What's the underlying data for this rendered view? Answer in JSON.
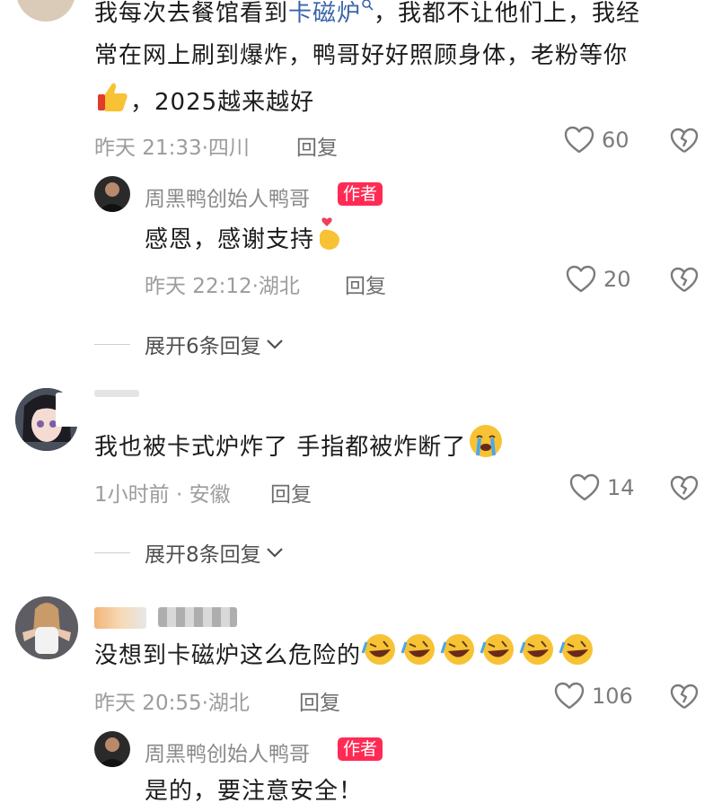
{
  "comments": [
    {
      "text_before": "我每次去餐馆看到",
      "keyword": "卡磁炉",
      "text_line1_rest": "，我都不让他们上，我经",
      "text_line2": "常在网上刷到爆炸，鸭哥好好照顾身体，老粉等你",
      "text_line3": "，2025越来越好",
      "time": "昨天 21:33",
      "location": "四川",
      "reply_label": "回复",
      "likes": "60",
      "author_reply": {
        "name": "周黑鸭创始人鸭哥",
        "badge": "作者",
        "text": "感恩，感谢支持",
        "time": "昨天 22:12",
        "location": "湖北",
        "reply_label": "回复",
        "likes": "20"
      },
      "expand_label": "展开6条回复"
    },
    {
      "text": "我也被卡式炉炸了 手指都被炸断了",
      "time": "1小时前",
      "location": "安徽",
      "reply_label": "回复",
      "likes": "14",
      "expand_label": "展开8条回复"
    },
    {
      "text": "没想到卡磁炉这么危险的",
      "time": "昨天 20:55",
      "location": "湖北",
      "reply_label": "回复",
      "likes": "106",
      "author_reply": {
        "name": "周黑鸭创始人鸭哥",
        "badge": "作者",
        "text": "是的，要注意安全！"
      }
    }
  ],
  "colors": {
    "badge": "#ff2b55",
    "keyword": "#3a64a8",
    "meta": "#9c9c9c"
  },
  "icons": {
    "like": "heart-icon",
    "dislike": "broken-heart-icon",
    "expand": "chevron-down-icon",
    "search": "search-icon"
  }
}
